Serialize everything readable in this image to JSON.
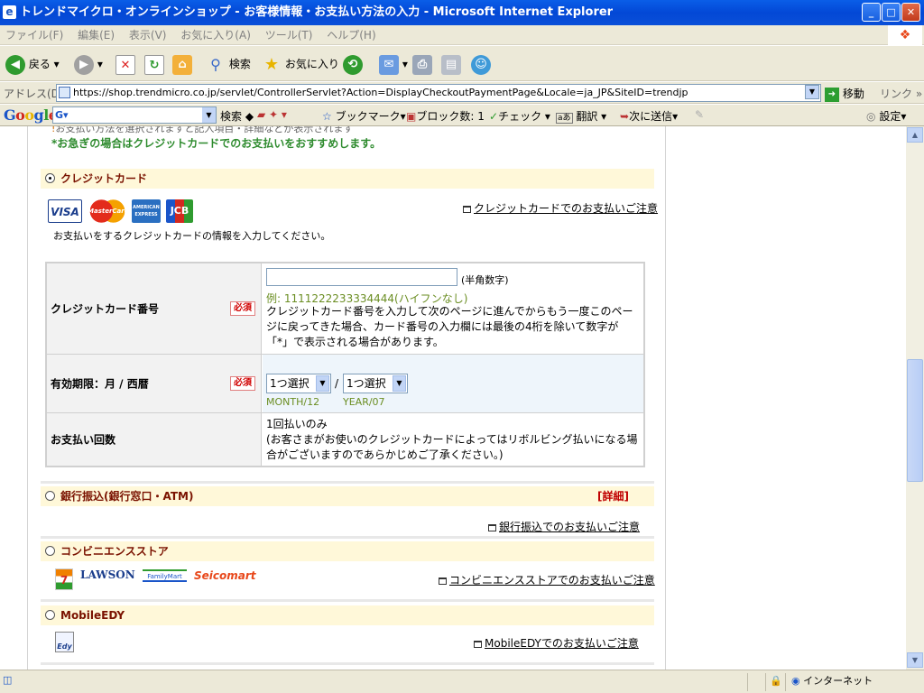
{
  "window": {
    "title": "トレンドマイクロ・オンラインショップ - お客様情報・お支払い方法の入力 - Microsoft Internet Explorer"
  },
  "menu": [
    "ファイル(F)",
    "編集(E)",
    "表示(V)",
    "お気に入り(A)",
    "ツール(T)",
    "ヘルプ(H)"
  ],
  "toolbar": {
    "back": "戻る",
    "search": "検索",
    "favorites": "お気に入り"
  },
  "address": {
    "label": "アドレス(D)",
    "url": "https://shop.trendmicro.co.jp/servlet/ControllerServlet?Action=DisplayCheckoutPaymentPage&Locale=ja_JP&SiteID=trendjp",
    "go": "移動",
    "links": "リンク"
  },
  "google": {
    "logo": "Google",
    "search": "検索",
    "bookmarks": "ブックマーク",
    "blocked": "ブロック数: 1",
    "check": "チェック",
    "translate": "翻訳",
    "send": "次に送信",
    "settings": "設定"
  },
  "page": {
    "top_note": "お支払い方法を選択されますと記入項目・詳細などが表示されます",
    "urgent_note": "*お急ぎの場合はクレジットカードでのお支払いをおすすめします。",
    "credit": {
      "heading": "クレジットカード",
      "selected": true,
      "brands": [
        "VISA",
        "MasterCard",
        "AMERICAN EXPRESS",
        "JCB"
      ],
      "notice_link": "クレジットカードでのお支払いご注意",
      "intro": "お支払いをするクレジットカードの情報を入力してください。",
      "card_number": {
        "label": "クレジットカード番号",
        "required": "必須",
        "hint": "(半角数字)",
        "example": "例: 1111222233334444(ハイフンなし)",
        "note": "クレジットカード番号を入力して次のページに進んでからもう一度このページに戻ってきた場合、カード番号の入力欄には最後の4桁を除いて数字が「*」で表示される場合があります。",
        "value": ""
      },
      "expiry": {
        "label": "有効期限：月 / 西暦",
        "required": "必須",
        "month_select": "1つ選択",
        "year_select": "1つ選択",
        "separator": "/",
        "month_example": "MONTH/12",
        "year_example": "YEAR/07"
      },
      "installments": {
        "label": "お支払い回数",
        "value": "1回払いのみ",
        "note": "(お客さまがお使いのクレジットカードによってはリボルビング払いになる場合がございますのであらかじめご了承ください。)"
      }
    },
    "bank": {
      "heading": "銀行振込(銀行窓口・ATM)",
      "detail": "[詳細]",
      "notice_link": "銀行振込でのお支払いご注意"
    },
    "convenience": {
      "heading": "コンビニエンスストア",
      "brands": [
        "7",
        "LAWSON",
        "FamilyMart",
        "Seicomart"
      ],
      "notice_link": "コンビニエンスストアでのお支払いご注意"
    },
    "edy": {
      "heading": "MobileEDY",
      "icon": "Edy",
      "notice_link": "MobileEDYでのお支払いご注意"
    }
  },
  "status": {
    "zone": "インターネット"
  }
}
